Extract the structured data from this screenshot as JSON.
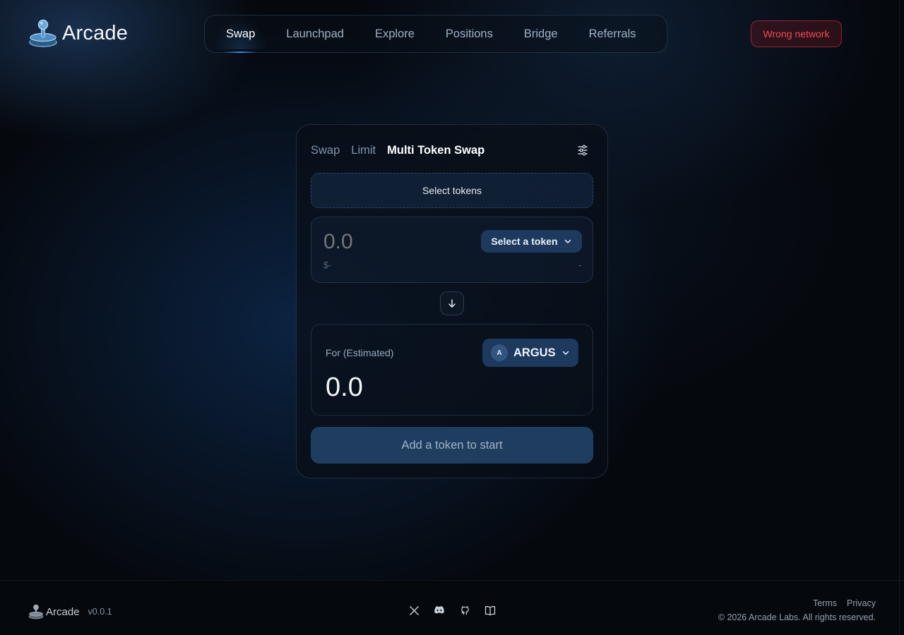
{
  "app": {
    "name": "Arcade",
    "version": "v0.0.1"
  },
  "header": {
    "nav": [
      {
        "label": "Swap",
        "active": true
      },
      {
        "label": "Launchpad",
        "active": false
      },
      {
        "label": "Explore",
        "active": false
      },
      {
        "label": "Positions",
        "active": false
      },
      {
        "label": "Bridge",
        "active": false
      },
      {
        "label": "Referrals",
        "active": false
      }
    ],
    "network_button": "Wrong network"
  },
  "swap_card": {
    "tabs": [
      {
        "label": "Swap",
        "active": false
      },
      {
        "label": "Limit",
        "active": false
      },
      {
        "label": "Multi Token Swap",
        "active": true
      }
    ],
    "settings_icon": "sliders-icon",
    "select_tokens_label": "Select tokens",
    "pay": {
      "amount_placeholder": "0.0",
      "usd_value": "$-",
      "balance": "-",
      "token_button": "Select a token"
    },
    "swap_direction_icon": "arrow-down-icon",
    "receive": {
      "label": "For (Estimated)",
      "amount": "0.0",
      "token_symbol": "ARGUS",
      "token_avatar_letter": "A"
    },
    "cta_label": "Add a token to start"
  },
  "footer": {
    "brand": "Arcade",
    "version": "v0.0.1",
    "social_icons": [
      "x-icon",
      "discord-icon",
      "github-icon",
      "docs-book-icon"
    ],
    "links": [
      "Terms",
      "Privacy"
    ],
    "copyright": "© 2026 Arcade Labs. All rights reserved."
  },
  "colors": {
    "background": "#05080d",
    "accent": "#3c8ce6",
    "button_fill": "#1d3a5e",
    "warning": "#ef4b55"
  }
}
